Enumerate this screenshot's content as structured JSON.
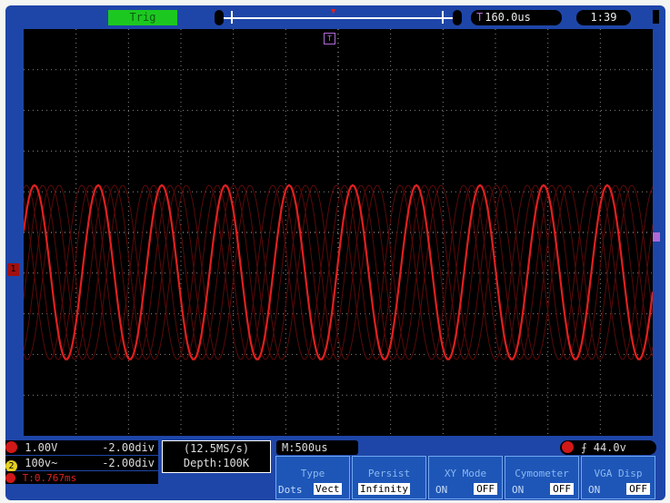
{
  "top": {
    "trig_label": "Trig",
    "trigger_delay": "160.0us",
    "clock": "1:39"
  },
  "channels": {
    "ch1_volts": "1.00V",
    "ch1_offset": "-2.00div",
    "ch2_volts": "100v~",
    "ch2_offset": "-2.00div",
    "ch2_number": "2",
    "cursor_time": "T:0.767ms"
  },
  "acquisition": {
    "sample_rate": "(12.5MS/s)",
    "depth": "Depth:100K",
    "timebase": "M:500us"
  },
  "trigger": {
    "level": "44.0v",
    "edge_icon": "rising-edge-icon"
  },
  "menu": {
    "type_label": "Type",
    "type_dots": "Dots",
    "type_vect": "Vect",
    "persist_label": "Persist",
    "persist_value": "Infinity",
    "xy_label": "XY Mode",
    "xy_on": "ON",
    "xy_off": "OFF",
    "cym_label": "Cymometer",
    "cym_on": "ON",
    "cym_off": "OFF",
    "vga_label": "VGA Disp",
    "vga_on": "ON",
    "vga_off": "OFF"
  },
  "colors": {
    "frame": "#1e46a8",
    "trace": "#e02020",
    "trig_ok": "#1cc820",
    "trigger_marker": "#b06ad8"
  }
}
